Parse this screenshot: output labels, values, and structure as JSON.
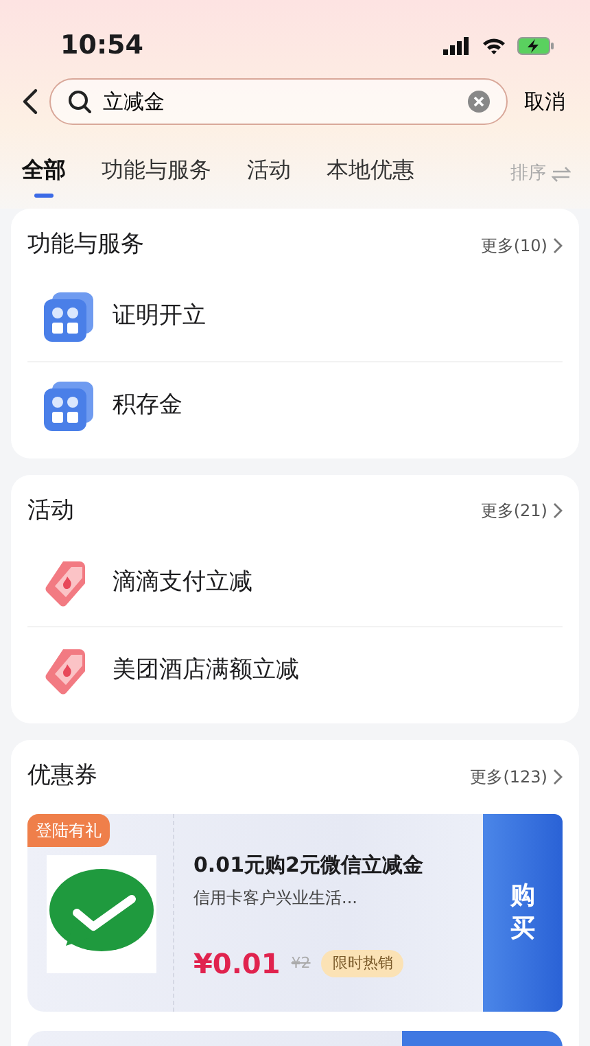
{
  "status_bar": {
    "time": "10:54"
  },
  "search": {
    "value": "立减金",
    "cancel": "取消"
  },
  "tabs": [
    {
      "label": "全部",
      "selected": true
    },
    {
      "label": "功能与服务",
      "selected": false
    },
    {
      "label": "活动",
      "selected": false
    },
    {
      "label": "本地优惠",
      "selected": false
    }
  ],
  "sort": {
    "label": "排序"
  },
  "sections": [
    {
      "kind": "services",
      "title": "功能与服务",
      "more": "更多(10)",
      "items": [
        {
          "label": "证明开立"
        },
        {
          "label": "积存金"
        }
      ]
    },
    {
      "kind": "activities",
      "title": "活动",
      "more": "更多(21)",
      "items": [
        {
          "label": "滴滴支付立减"
        },
        {
          "label": "美团酒店满额立减"
        }
      ]
    },
    {
      "kind": "coupons",
      "title": "优惠券",
      "more": "更多(123)",
      "items": [
        {
          "tag": "登陆有礼",
          "title": "0.01元购2元微信立减金",
          "subtitle": "信用卡客户兴业生活...",
          "price": "¥0.01",
          "original_price": "¥2",
          "badge": "限时热销",
          "action": "购买"
        }
      ]
    }
  ]
}
